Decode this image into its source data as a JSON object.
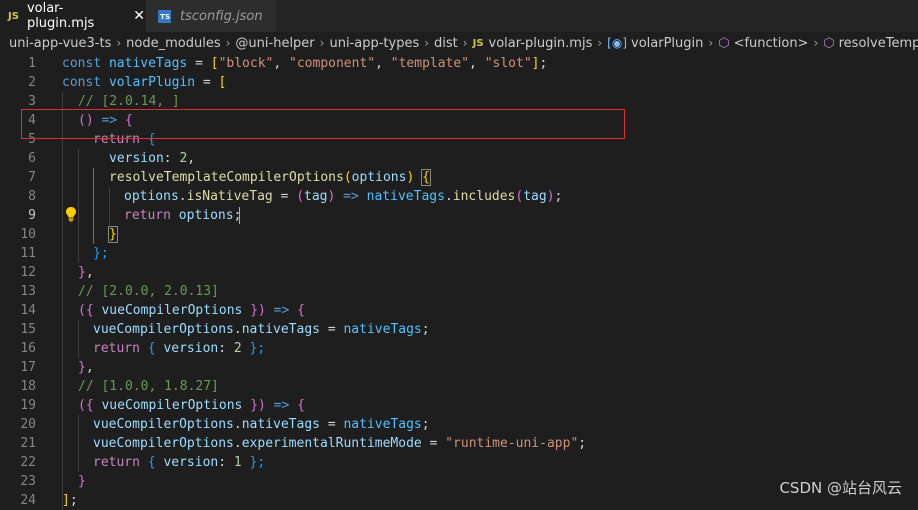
{
  "tabs": [
    {
      "badge": "JS",
      "label": "volar-plugin.mjs",
      "close": "✕"
    },
    {
      "badge": "TS",
      "label": "tsconfig.json"
    }
  ],
  "breadcrumb": {
    "items": [
      "uni-app-vue3-ts",
      "node_modules",
      "@uni-helper",
      "uni-app-types",
      "dist"
    ],
    "file_badge": "JS",
    "file": "volar-plugin.mjs",
    "symbol": "volarPlugin",
    "function": "<function>",
    "method": "resolveTemplateCompi"
  },
  "lines": {
    "1": {
      "num": "1",
      "t1": "const",
      "t2": "nativeTags",
      "t3": " = ",
      "t4": "[",
      "t5": "\"block\"",
      "t6": ", ",
      "t7": "\"component\"",
      "t8": ", ",
      "t9": "\"template\"",
      "t10": ", ",
      "t11": "\"slot\"",
      "t12": "]",
      "t13": ";"
    },
    "2": {
      "num": "2",
      "t1": "const",
      "t2": "volarPlugin",
      "t3": " = ",
      "t4": "["
    },
    "3": {
      "num": "3",
      "t1": "// [2.0.14, ]"
    },
    "4": {
      "num": "4",
      "t1": "()",
      "t2": " => ",
      "t3": "{"
    },
    "5": {
      "num": "5",
      "t1": "return",
      "t2": " {"
    },
    "6": {
      "num": "6",
      "t1": "version",
      "t2": ": ",
      "t3": "2",
      "t4": ","
    },
    "7": {
      "num": "7",
      "t1": "resolveTemplateCompilerOptions",
      "t2": "(",
      "t3": "options",
      "t4": ")",
      "t5": " ",
      "t6": "{"
    },
    "8": {
      "num": "8",
      "t1": "options",
      "t2": ".",
      "t3": "isNativeTag",
      "t4": " = ",
      "t5": "(",
      "t6": "tag",
      "t7": ")",
      "t8": " => ",
      "t9": "nativeTags",
      "t10": ".",
      "t11": "includes",
      "t12": "(",
      "t13": "tag",
      "t14": ")",
      "t15": ";"
    },
    "9": {
      "num": "9",
      "t1": "return",
      "t2": " ",
      "t3": "options",
      "t4": ";"
    },
    "10": {
      "num": "10",
      "t1": "}"
    },
    "11": {
      "num": "11",
      "t1": "};"
    },
    "12": {
      "num": "12",
      "t1": "}",
      "t2": ","
    },
    "13": {
      "num": "13",
      "t1": "// [2.0.0, 2.0.13]"
    },
    "14": {
      "num": "14",
      "t1": "({",
      "t2": " ",
      "t3": "vueCompilerOptions",
      "t4": " ",
      "t5": "})",
      "t6": " => ",
      "t7": "{"
    },
    "15": {
      "num": "15",
      "t1": "vueCompilerOptions",
      "t2": ".",
      "t3": "nativeTags",
      "t4": " = ",
      "t5": "nativeTags",
      "t6": ";"
    },
    "16": {
      "num": "16",
      "t1": "return",
      "t2": " { ",
      "t3": "version",
      "t4": ": ",
      "t5": "2",
      "t6": " };"
    },
    "17": {
      "num": "17",
      "t1": "}",
      "t2": ","
    },
    "18": {
      "num": "18",
      "t1": "// [1.0.0, 1.8.27]"
    },
    "19": {
      "num": "19",
      "t1": "({",
      "t2": " ",
      "t3": "vueCompilerOptions",
      "t4": " ",
      "t5": "})",
      "t6": " => ",
      "t7": "{"
    },
    "20": {
      "num": "20",
      "t1": "vueCompilerOptions",
      "t2": ".",
      "t3": "nativeTags",
      "t4": " = ",
      "t5": "nativeTags",
      "t6": ";"
    },
    "21": {
      "num": "21",
      "t1": "vueCompilerOptions",
      "t2": ".",
      "t3": "experimentalRuntimeMode",
      "t4": " = ",
      "t5": "\"runtime-uni-app\"",
      "t6": ";"
    },
    "22": {
      "num": "22",
      "t1": "return",
      "t2": " { ",
      "t3": "version",
      "t4": ": ",
      "t5": "1",
      "t6": " };"
    },
    "23": {
      "num": "23",
      "t1": "}"
    },
    "24": {
      "num": "24",
      "t1": "]",
      "t2": ";"
    }
  },
  "active_line": "9",
  "highlight_color": "#e02f2f",
  "watermark": "CSDN @站台风云"
}
